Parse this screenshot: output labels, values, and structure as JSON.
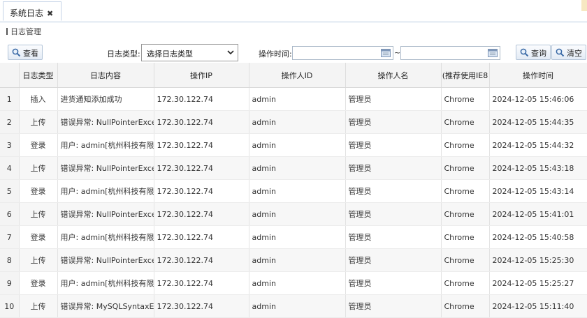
{
  "tab": {
    "label": "系统日志",
    "close": "✖"
  },
  "breadcrumb": "日志管理",
  "toolbar": {
    "view_label": "查看",
    "type_label": "日志类型:",
    "type_selected": "选择日志类型",
    "time_label": "操作时间:",
    "time_sep": "~",
    "search_label": "查询",
    "clear_label": "清空"
  },
  "columns": [
    "日志类型",
    "日志内容",
    "操作IP",
    "操作人ID",
    "操作人名",
    "(推荐使用IE8",
    "操作时间"
  ],
  "rows": [
    {
      "no": "1",
      "type": "插入",
      "content": "进货通知添加成功",
      "ip": "172.30.122.74",
      "uid": "admin",
      "uname": "管理员",
      "browser": "Chrome",
      "time": "2024-12-05 15:46:06"
    },
    {
      "no": "2",
      "type": "上传",
      "content": "错误异常: NullPointerException",
      "ip": "172.30.122.74",
      "uid": "admin",
      "uname": "管理员",
      "browser": "Chrome",
      "time": "2024-12-05 15:44:35"
    },
    {
      "no": "3",
      "type": "登录",
      "content": "用户: admin[杭州科技有限公司]",
      "ip": "172.30.122.74",
      "uid": "admin",
      "uname": "管理员",
      "browser": "Chrome",
      "time": "2024-12-05 15:44:32"
    },
    {
      "no": "4",
      "type": "上传",
      "content": "错误异常: NullPointerException",
      "ip": "172.30.122.74",
      "uid": "admin",
      "uname": "管理员",
      "browser": "Chrome",
      "time": "2024-12-05 15:43:18"
    },
    {
      "no": "5",
      "type": "登录",
      "content": "用户: admin[杭州科技有限公司]",
      "ip": "172.30.122.74",
      "uid": "admin",
      "uname": "管理员",
      "browser": "Chrome",
      "time": "2024-12-05 15:43:14"
    },
    {
      "no": "6",
      "type": "上传",
      "content": "错误异常: NullPointerException",
      "ip": "172.30.122.74",
      "uid": "admin",
      "uname": "管理员",
      "browser": "Chrome",
      "time": "2024-12-05 15:41:01"
    },
    {
      "no": "7",
      "type": "登录",
      "content": "用户: admin[杭州科技有限公司]",
      "ip": "172.30.122.74",
      "uid": "admin",
      "uname": "管理员",
      "browser": "Chrome",
      "time": "2024-12-05 15:40:58"
    },
    {
      "no": "8",
      "type": "上传",
      "content": "错误异常: NullPointerException",
      "ip": "172.30.122.74",
      "uid": "admin",
      "uname": "管理员",
      "browser": "Chrome",
      "time": "2024-12-05 15:25:30"
    },
    {
      "no": "9",
      "type": "登录",
      "content": "用户: admin[杭州科技有限公司]",
      "ip": "172.30.122.74",
      "uid": "admin",
      "uname": "管理员",
      "browser": "Chrome",
      "time": "2024-12-05 15:25:27"
    },
    {
      "no": "10",
      "type": "上传",
      "content": "错误异常: MySQLSyntaxErrorException",
      "ip": "172.30.122.74",
      "uid": "admin",
      "uname": "管理员",
      "browser": "Chrome",
      "time": "2024-12-05 15:11:40"
    }
  ]
}
